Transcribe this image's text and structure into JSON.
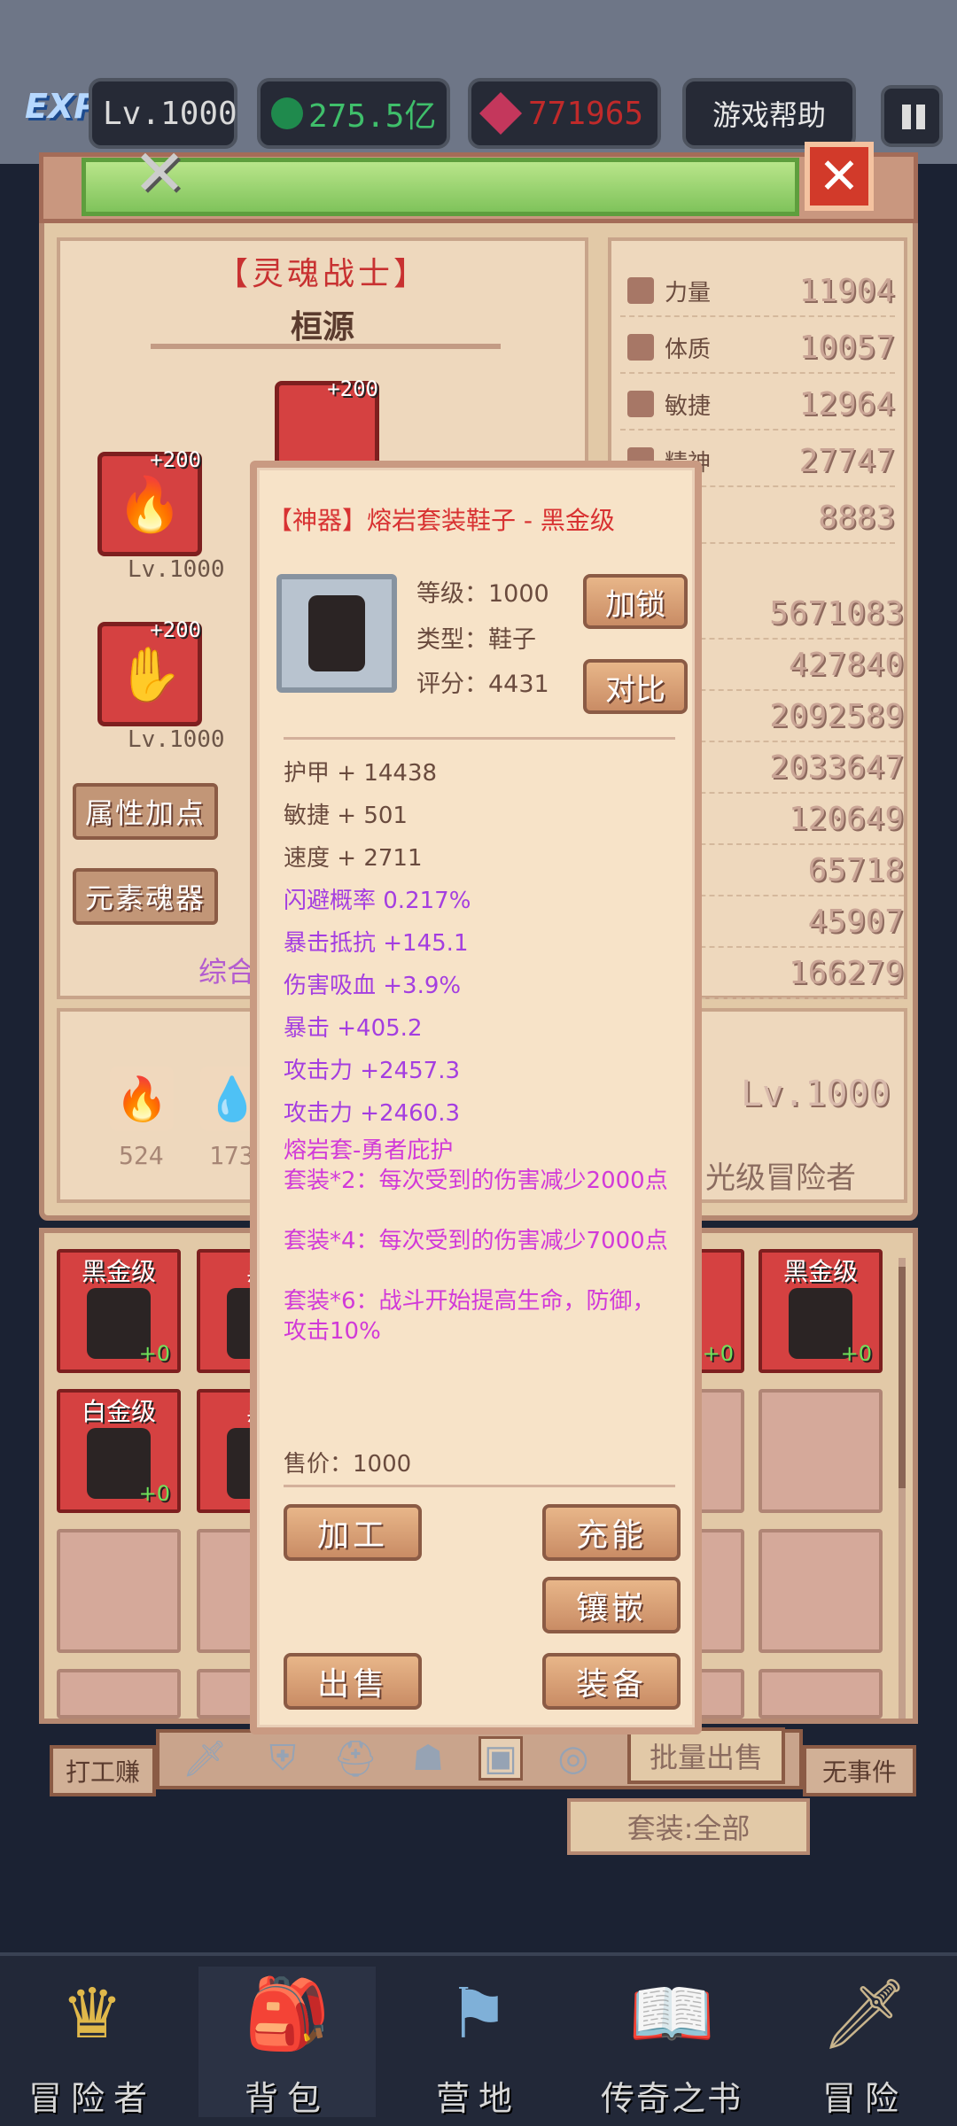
{
  "topbar": {
    "exp_label": "EXP",
    "level": "Lv.1000",
    "gold": "275.5亿",
    "gems": "771965",
    "help": "游戏帮助"
  },
  "hero": {
    "title": "【灵魂战士】",
    "name": "桓源",
    "weapon_plus": "+200",
    "weapon_lv": "Lv.1000",
    "helmet_plus": "+200",
    "gloves_plus": "+200",
    "gloves_lv": "Lv.1000",
    "attr_btn": "属性加点",
    "soul_btn": "元素魂器",
    "combined_label": "综合"
  },
  "stats": [
    {
      "label": "力量",
      "value": "11904"
    },
    {
      "label": "体质",
      "value": "10057"
    },
    {
      "label": "敏捷",
      "value": "12964"
    },
    {
      "label": "精神",
      "value": "27747"
    },
    {
      "label": "",
      "value": "8883"
    }
  ],
  "combat_stats": [
    "5671083",
    "427840",
    "2092589",
    "2033647",
    "120649",
    "65718",
    "45907",
    "166279"
  ],
  "lower": {
    "fire_count": "524",
    "water_count": "173",
    "level": "Lv.1000",
    "rank": "光级冒险者"
  },
  "inventory": {
    "tags": [
      "黑金级",
      "黑",
      "级",
      "黑金级",
      "白金级",
      "黑"
    ],
    "count": "+0"
  },
  "tabs": {
    "batch_sell": "批量出售",
    "work": "打工赚",
    "no_event": "无事件",
    "suit_filter": "套装:全部"
  },
  "popup": {
    "title": "【神器】熔岩套装鞋子 - 黑金级",
    "level": "等级：1000",
    "type": "类型：鞋子",
    "score": "评分：4431",
    "lock_btn": "加锁",
    "compare_btn": "对比",
    "attrs_normal": [
      "护甲 + 14438",
      "敏捷 + 501",
      "速度 + 2711"
    ],
    "attrs_purple": [
      "闪避概率 0.217%",
      "暴击抵抗 +145.1",
      "伤害吸血 +3.9%",
      "暴击 +405.2",
      "攻击力 +2457.3",
      "攻击力 +2460.3"
    ],
    "set_name": "熔岩套-勇者庇护",
    "set_2": "套装*2：每次受到的伤害减少2000点",
    "set_4": "套装*4：每次受到的伤害减少7000点",
    "set_6": "套装*6：战斗开始提高生命，防御，攻击10%",
    "price": "售价：1000",
    "craft_btn": "加工",
    "charge_btn": "充能",
    "inlay_btn": "镶嵌",
    "sell_btn": "出售",
    "equip_btn": "装备"
  },
  "nav": [
    {
      "label": "冒险者",
      "icon": "crown-icon"
    },
    {
      "label": "背包",
      "icon": "backpack-icon"
    },
    {
      "label": "营地",
      "icon": "camp-banner-icon"
    },
    {
      "label": "传奇之书",
      "icon": "book-icon"
    },
    {
      "label": "冒险",
      "icon": "sword-icon"
    }
  ]
}
